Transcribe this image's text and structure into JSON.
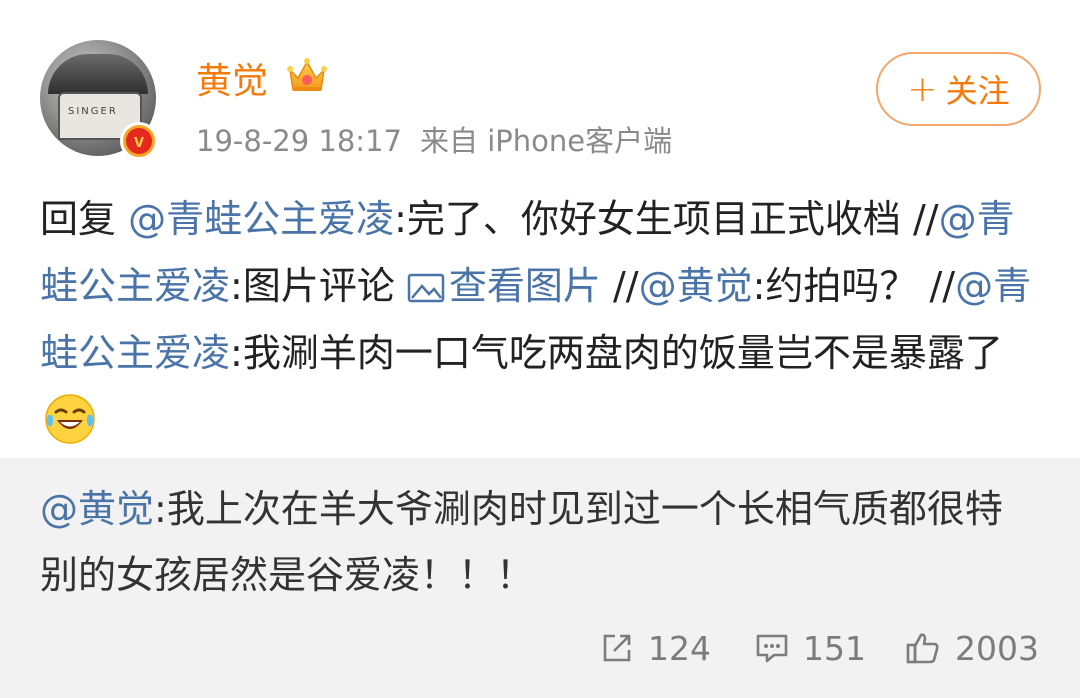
{
  "post": {
    "author": "黄觉",
    "time": "19-8-29 18:17",
    "source": "来自 iPhone客户端",
    "follow_label": "关注",
    "follow_plus": "+",
    "content": {
      "p1": "回复 ",
      "m1": "@青蛙公主爱凌",
      "p2": ":完了、你好女生项目正式收档 //",
      "m2": "@青蛙公主爱凌",
      "p3": ":图片评论 ",
      "link": "查看图片",
      "p4": " //",
      "m3": "@黄觉",
      "p5": ":约拍吗？ //",
      "m4": "@青蛙公主爱凌",
      "p6": ":我涮羊肉一口气吃两盘肉的饭量岂不是暴露了"
    }
  },
  "quote": {
    "mention": "@黄觉",
    "text": ":我上次在羊大爷涮肉时见到过一个长相气质都很特别的女孩居然是谷爱凌！！！",
    "reposts": "124",
    "comments": "151",
    "likes": "2003"
  },
  "avatar": {
    "logo_text": "SINGER"
  },
  "colors": {
    "username": "#f47a0b",
    "mention": "#4a74a8",
    "quote_bg": "#f2f2f2",
    "meta": "#8a8a8a"
  }
}
